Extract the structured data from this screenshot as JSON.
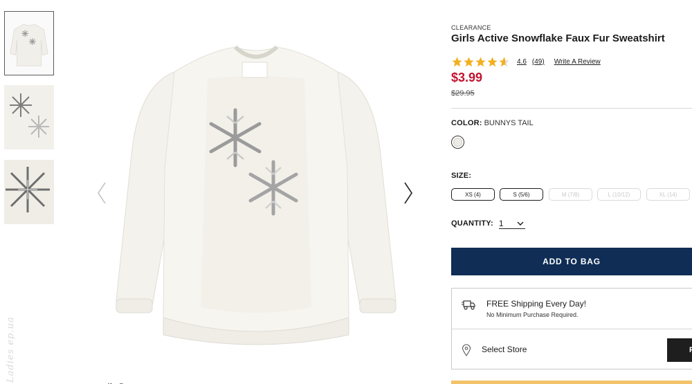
{
  "thumbnails": [
    {
      "name": "front-view"
    },
    {
      "name": "detail-snowflakes"
    },
    {
      "name": "closeup-snowflake"
    }
  ],
  "watermark_text": "Ladies ep.ua",
  "main_image": {
    "name": "Girls Active Snowflake Faux Fur Sweatshirt"
  },
  "product": {
    "breadcrumb": "CLEARANCE",
    "title": "Girls Active Snowflake Faux Fur Sweatshirt",
    "rating": 4.6,
    "rating_text": "4.6",
    "review_count": "(49)",
    "write_review": "Write A Review",
    "sale_price": "$3.99",
    "original_price": "$29.95"
  },
  "color": {
    "label": "COLOR:",
    "value": "BUNNYS TAIL",
    "swatch_hex": "#ecebe4"
  },
  "size": {
    "label": "SIZE:",
    "options": [
      {
        "label": "XS (4)",
        "available": true
      },
      {
        "label": "S (5/6)",
        "available": true
      },
      {
        "label": "M (7/8)",
        "available": false
      },
      {
        "label": "L (10/12)",
        "available": false
      },
      {
        "label": "XL (14)",
        "available": false
      }
    ]
  },
  "quantity": {
    "label": "QUANTITY:",
    "value": "1"
  },
  "add_to_bag": "ADD TO BAG",
  "shipping": {
    "title": "FREE Shipping Every Day!",
    "subtitle": "No Minimum Purchase Required.",
    "select_store": "Select Store",
    "store_button": "F"
  },
  "colors": {
    "sale_red": "#c4122f",
    "button_navy": "#0f2d55",
    "star_gold": "#f2b01e"
  }
}
